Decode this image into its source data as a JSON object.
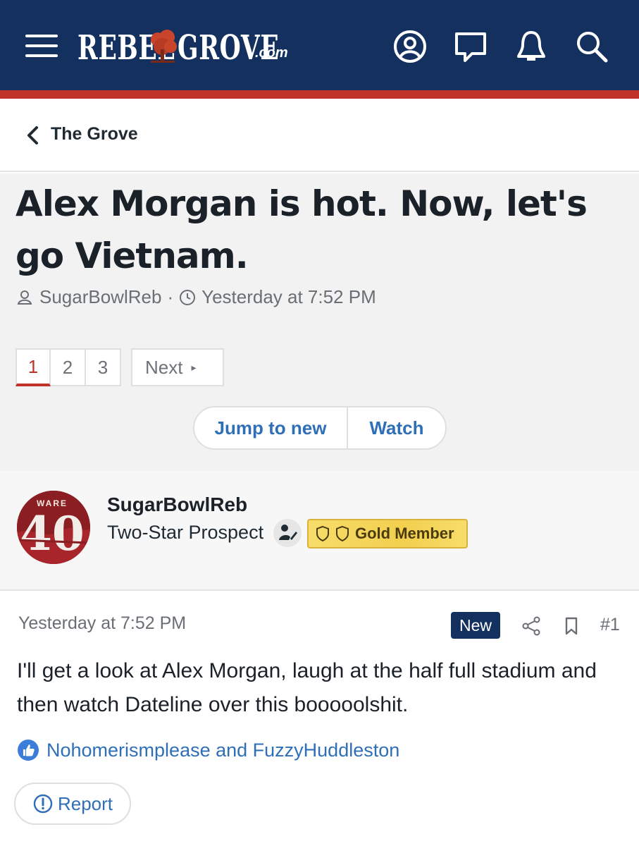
{
  "header": {
    "logo_left": "REBEL",
    "logo_right": "GROVE",
    "logo_tld": ".com",
    "icons": [
      "menu-icon",
      "account-icon",
      "messages-icon",
      "alerts-icon",
      "search-icon"
    ],
    "colors": {
      "bar": "#14305e",
      "accent": "#c0332a"
    }
  },
  "breadcrumb": {
    "label": "The Grove"
  },
  "thread": {
    "title": "Alex Morgan is hot. Now, let's go Vietnam.",
    "author": "SugarBowlReb",
    "separator": "·",
    "date": "Yesterday at 7:52 PM",
    "pages": [
      "1",
      "2",
      "3"
    ],
    "current_page": "1",
    "next_label": "Next",
    "next_arrow": "▸",
    "jump_label": "Jump to new",
    "watch_label": "Watch"
  },
  "author_block": {
    "name": "SugarBowlReb",
    "rank": "Two-Star Prospect",
    "badge": "Gold Member",
    "avatar_text_top": "WARE",
    "avatar_text_num": "40"
  },
  "post": {
    "time": "Yesterday at 7:52 PM",
    "new_badge": "New",
    "number": "#1",
    "body": "I'll get a look at Alex Morgan, laugh at the half full stadium and then watch Dateline over this booooolshit.",
    "likes": "Nohomerismplease and FuzzyHuddleston",
    "report_label": "Report"
  }
}
